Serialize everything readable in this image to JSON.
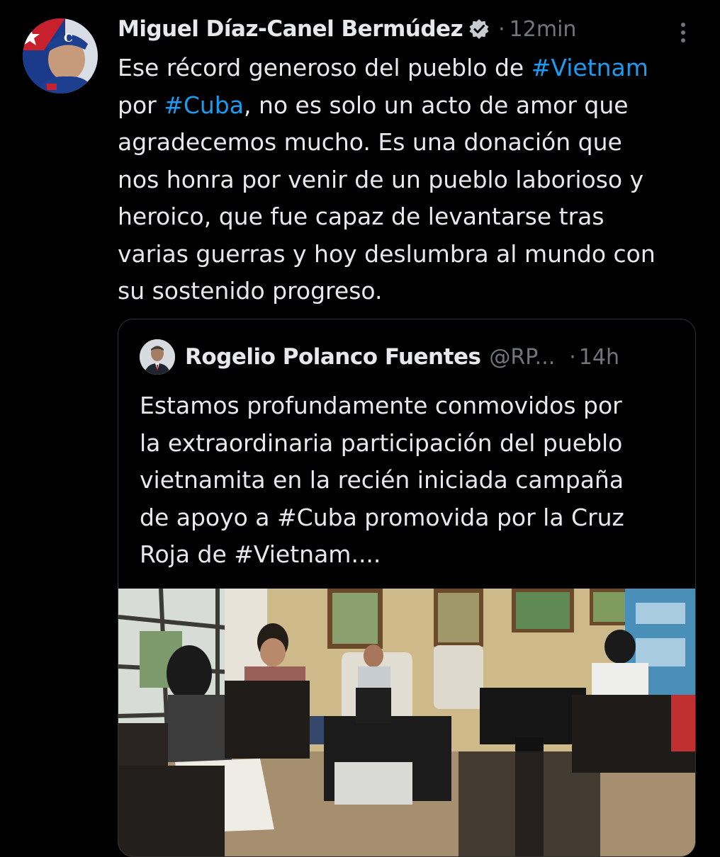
{
  "tweet": {
    "author_name": "Miguel Díaz-Canel Bermúdez",
    "separator": "·",
    "time": "12min",
    "text_lines": [
      [
        {
          "t": "Ese récord generoso del pueblo de "
        },
        {
          "t": "#Vietnam",
          "tag": true
        }
      ],
      [
        {
          "t": "por "
        },
        {
          "t": "#Cuba",
          "tag": true
        },
        {
          "t": ", no es solo un acto de amor que"
        }
      ],
      [
        {
          "t": "agradecemos mucho. Es una donación que"
        }
      ],
      [
        {
          "t": "nos honra  por venir de un pueblo laborioso y"
        }
      ],
      [
        {
          "t": "heroico, que fue capaz de levantarse tras"
        }
      ],
      [
        {
          "t": "varias guerras y hoy deslumbra al mundo con"
        }
      ],
      [
        {
          "t": "su sostenido progreso."
        }
      ]
    ]
  },
  "quote": {
    "author_name": "Rogelio Polanco Fuentes",
    "handle": "@RP...",
    "separator": "·",
    "time": "14h",
    "text_lines": [
      "Estamos profundamente conmovidos por",
      "la extraordinaria participación del pueblo",
      "vietnamita en la recién iniciada campaña",
      "de apoyo a #Cuba promovida por la Cruz",
      "Roja de #Vietnam...."
    ]
  },
  "icons": {
    "verified": "verified-badge-icon",
    "more": "more-options-icon"
  },
  "colors": {
    "background": "#000000",
    "text": "#e7e9ea",
    "secondary": "#71767b",
    "link": "#1d9bf0",
    "border": "#2f3336"
  }
}
